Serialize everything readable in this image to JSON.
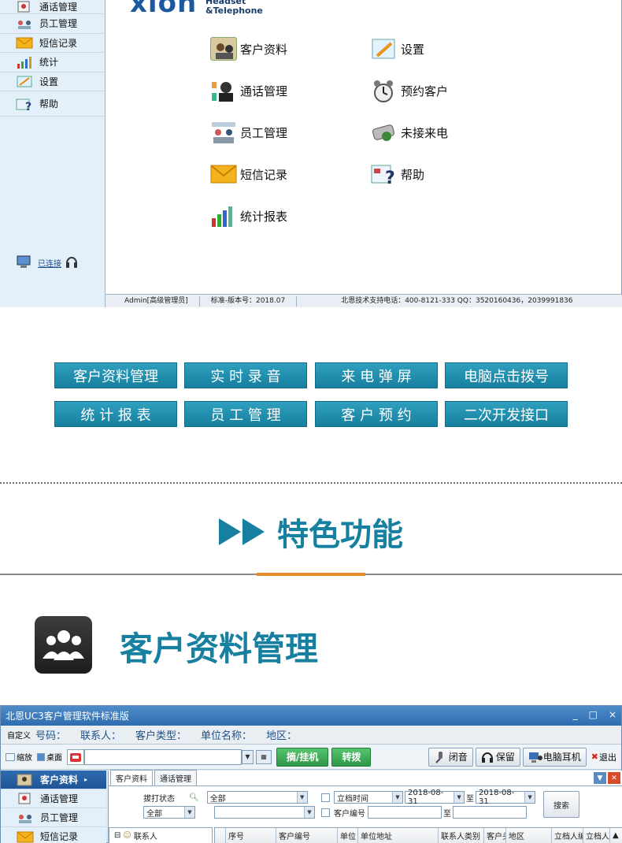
{
  "top_app": {
    "sidebar_items": [
      "通话管理",
      "员工管理",
      "短信记录",
      "统计",
      "设置",
      "帮助"
    ],
    "logo_main": "xion",
    "logo_sub_1": "Headset",
    "logo_sub_2": "&Telephone",
    "grid": [
      {
        "label": "客户资料",
        "icon": "customer-info-icon"
      },
      {
        "label": "设置",
        "icon": "settings-icon"
      },
      {
        "label": "通话管理",
        "icon": "call-management-icon"
      },
      {
        "label": "预约客户",
        "icon": "alarm-clock-icon"
      },
      {
        "label": "员工管理",
        "icon": "staff-icon"
      },
      {
        "label": "未接来电",
        "icon": "missed-call-icon"
      },
      {
        "label": "短信记录",
        "icon": "envelope-icon"
      },
      {
        "label": "帮助",
        "icon": "help-icon"
      },
      {
        "label": "统计报表",
        "icon": "bar-chart-icon"
      }
    ],
    "connected": "已连接",
    "status": {
      "user": "Admin[高级管理员]",
      "version": "标准-版本号：2018.07",
      "support": "北恩技术支持电话：400-8121-333  QQ：3520160436，2039991836"
    }
  },
  "features": [
    "客户资料管理",
    "实 时 录 音",
    "来 电 弹 屏",
    "电脑点击拨号",
    "统 计 报 表",
    "员 工 管 理",
    "客 户 预 约",
    "二次开发接口"
  ],
  "feature_heading": "特色功能",
  "section_heading": "客户资料管理",
  "bottom_app": {
    "title": "北恩UC3客户管理软件标准版",
    "win_buttons": [
      "_",
      "□",
      "×"
    ],
    "custom": "自定义",
    "fields": [
      "号码：",
      "联系人：",
      "客户类型：",
      "单位名称：",
      "地区："
    ],
    "shrink": "缩放",
    "desktop": "桌面",
    "answer_btn": "摘/挂机",
    "transfer_btn": "转拨",
    "mute_btn": "闭音",
    "hold_btn": "保留",
    "headset_btn": "电脑耳机",
    "exit_btn": "退出",
    "sidebar": [
      "客户资料",
      "通话管理",
      "员工管理",
      "短信记录"
    ],
    "tabs": [
      "客户资料",
      "通话管理"
    ],
    "filter": {
      "dial_status_label": "拔打状态",
      "status_all": "全部",
      "all_2": "全部",
      "date_field": "立档时间",
      "date_from": "2018-08-31",
      "to": "至",
      "date_to": "2018-08-31",
      "customer_no": "客户编号",
      "search": "搜索"
    },
    "tree_root": "联系人",
    "columns": [
      "序号",
      "客户编号",
      "单位",
      "单位地址",
      "联系人类别",
      "客户头",
      "地区",
      "立档人编",
      "立档人"
    ]
  }
}
